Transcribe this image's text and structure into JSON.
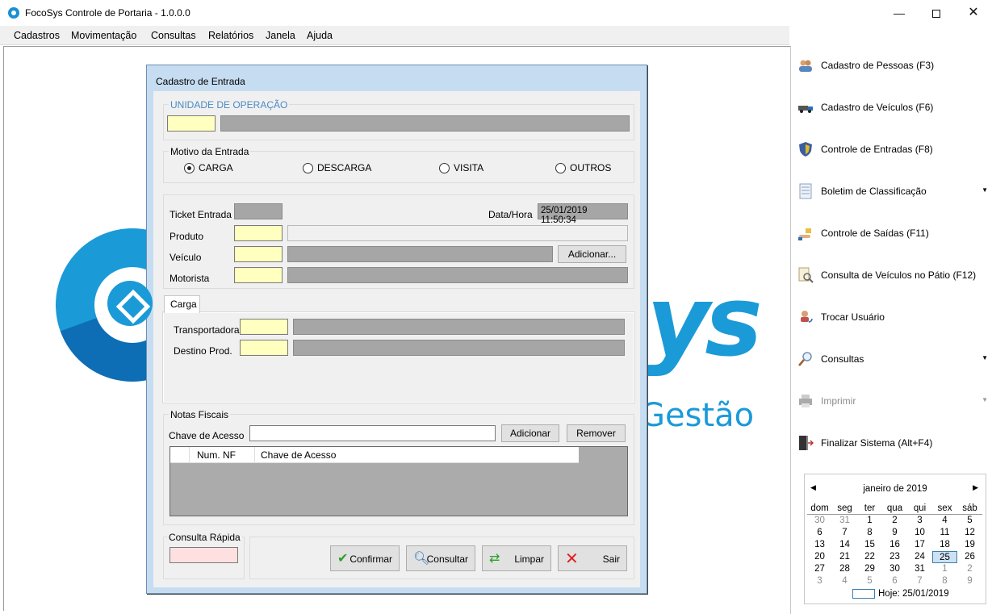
{
  "window": {
    "title": "FocoSys Controle de Portaria - 1.0.0.0",
    "minimize": "—",
    "close": "✕"
  },
  "menu": [
    "Cadastros",
    "Movimentação",
    "Consultas",
    "Relatórios",
    "Janela",
    "Ajuda"
  ],
  "logo": {
    "text": "ys",
    "subtitle": "Gestão"
  },
  "dialog": {
    "title": "Cadastro de Entrada",
    "unidade": {
      "label": "UNIDADE DE OPERAÇÃO"
    },
    "motivo": {
      "label": "Motivo da Entrada",
      "options": [
        "CARGA",
        "DESCARGA",
        "VISITA",
        "OUTROS"
      ],
      "selected": "CARGA"
    },
    "ticket_label": "Ticket Entrada",
    "datahora_label": "Data/Hora",
    "datahora_value": "25/01/2019 11:50:34",
    "produto_label": "Produto",
    "veiculo_label": "Veículo",
    "motorista_label": "Motorista",
    "adicionar_veiculo": "Adicionar...",
    "tab_carga": "Carga",
    "transportadora_label": "Transportadora",
    "destino_label": "Destino Prod.",
    "notas": {
      "label": "Notas Fiscais",
      "chave_label": "Chave de Acesso",
      "add_button": "Adicionar",
      "remove_button": "Remover",
      "columns": [
        "Num. NF",
        "Chave de Acesso"
      ]
    },
    "consulta_rapida": "Consulta Rápida",
    "actions": {
      "confirmar": "Confirmar",
      "consultar": "Consultar",
      "limpar": "Limpar",
      "sair": "Sair"
    }
  },
  "sidebar": {
    "items": [
      {
        "label": "Cadastro de Pessoas (F3)",
        "icon": "people-icon"
      },
      {
        "label": "Cadastro de Veículos (F6)",
        "icon": "truck-icon"
      },
      {
        "label": "Controle de Entradas (F8)",
        "icon": "shield-icon"
      },
      {
        "label": "Boletim de Classificação",
        "icon": "document-icon",
        "has_dropdown": true
      },
      {
        "label": "Controle de Saídas (F11)",
        "icon": "hand-icon"
      },
      {
        "label": "Consulta de Veículos no Pátio (F12)",
        "icon": "search-document-icon"
      },
      {
        "label": "Trocar Usuário",
        "icon": "user-switch-icon"
      },
      {
        "label": "Consultas",
        "icon": "magnifier-icon",
        "has_dropdown": true
      },
      {
        "label": "Imprimir",
        "icon": "printer-icon",
        "has_dropdown": true,
        "disabled": true
      },
      {
        "label": "Finalizar Sistema (Alt+F4)",
        "icon": "exit-door-icon"
      }
    ]
  },
  "calendar": {
    "month": "janeiro de 2019",
    "weekdays": [
      "dom",
      "seg",
      "ter",
      "qua",
      "qui",
      "sex",
      "sáb"
    ],
    "weeks": [
      [
        "30",
        "31",
        "1",
        "2",
        "3",
        "4",
        "5"
      ],
      [
        "6",
        "7",
        "8",
        "9",
        "10",
        "11",
        "12"
      ],
      [
        "13",
        "14",
        "15",
        "16",
        "17",
        "18",
        "19"
      ],
      [
        "20",
        "21",
        "22",
        "23",
        "24",
        "25",
        "26"
      ],
      [
        "27",
        "28",
        "29",
        "30",
        "31",
        "1",
        "2"
      ],
      [
        "3",
        "4",
        "5",
        "6",
        "7",
        "8",
        "9"
      ]
    ],
    "selected": "25",
    "today": "Hoje: 25/01/2019"
  }
}
